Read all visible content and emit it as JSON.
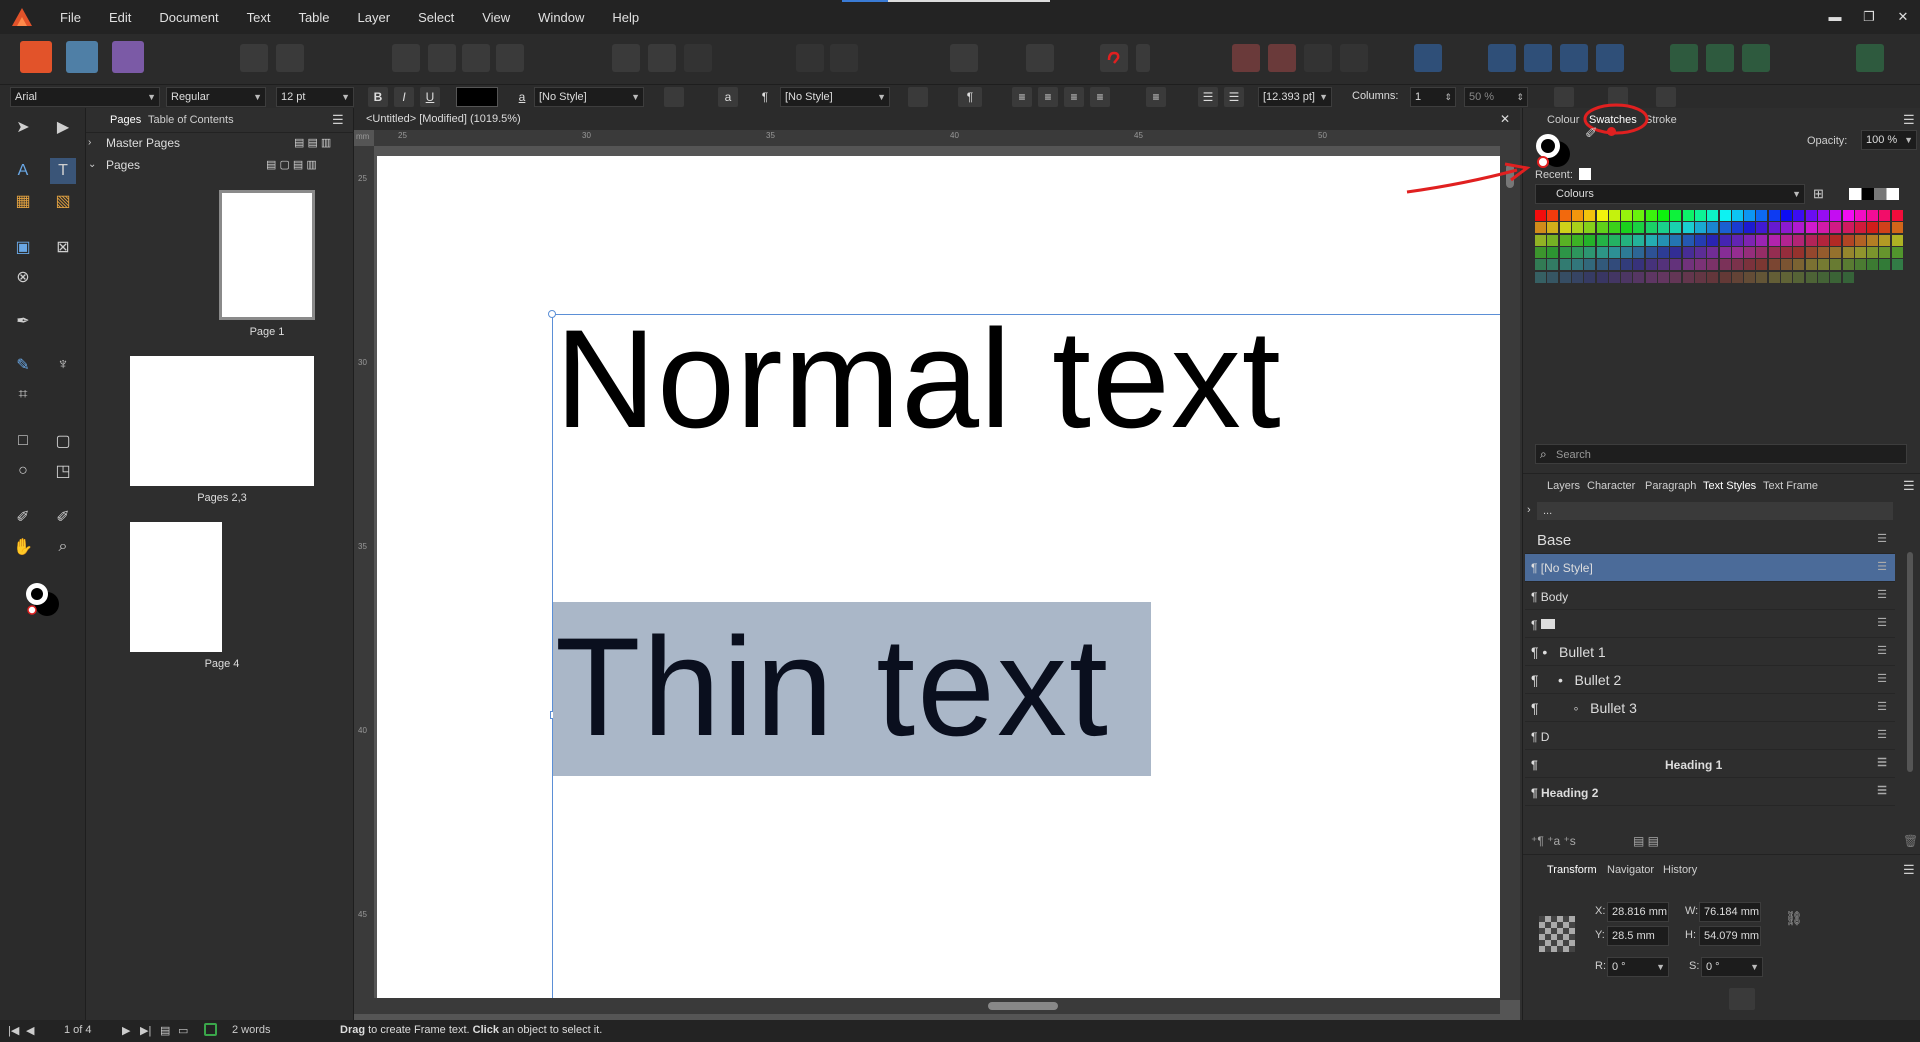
{
  "menu": [
    "File",
    "Edit",
    "Document",
    "Text",
    "Table",
    "Layer",
    "Select",
    "View",
    "Window",
    "Help"
  ],
  "window_controls": {
    "minimize": "▬",
    "maximize": "❐",
    "close": "✕"
  },
  "context": {
    "font_family": "Arial",
    "font_style": "Regular",
    "font_size": "12 pt",
    "bold": "B",
    "italic": "I",
    "underline": "U",
    "char_style_glyph": "a",
    "char_style": "[No Style]",
    "para_glyph": "¶",
    "para_style": "[No Style]",
    "baseline": "[12.393 pt]",
    "columns_label": "Columns:",
    "columns_value": "1",
    "gutter": "50 %",
    "text_color": "#000000"
  },
  "pages_panel": {
    "tabs": [
      "Pages",
      "Table of Contents"
    ],
    "master_pages": "Master Pages",
    "pages_header": "Pages",
    "pages": [
      "Page 1",
      "Pages 2,3",
      "Page 4"
    ]
  },
  "document": {
    "tab_title": "<Untitled> [Modified] (1019.5%)",
    "ruler_unit": "mm",
    "ruler_h": [
      "25",
      "30",
      "35",
      "40",
      "45",
      "50"
    ],
    "ruler_v": [
      "25",
      "30",
      "35",
      "40",
      "45"
    ],
    "text_normal": "Normal text",
    "text_thin": "Thin text"
  },
  "swatches_panel": {
    "tabs": [
      "Colour",
      "Swatches",
      "Stroke"
    ],
    "opacity_label": "Opacity:",
    "opacity_value": "100 %",
    "recent_label": "Recent:",
    "palette": "Colours",
    "search_placeholder": "Search"
  },
  "styles_panel": {
    "tabs": [
      "Layers",
      "Character",
      "Paragraph",
      "Text Styles",
      "Text Frame"
    ],
    "filter": "...",
    "group": "Base",
    "styles": [
      "[No Style]",
      "Body",
      "",
      "Bullet 1",
      "Bullet 2",
      "Bullet 3",
      "D",
      "Heading 1",
      "Heading 2"
    ]
  },
  "transform_panel": {
    "tabs": [
      "Transform",
      "Navigator",
      "History"
    ],
    "x_label": "X:",
    "x": "28.816 mm",
    "w_label": "W:",
    "w": "76.184 mm",
    "y_label": "Y:",
    "y": "28.5 mm",
    "h_label": "H:",
    "h": "54.079 mm",
    "r_label": "R:",
    "r": "0 °",
    "s_label": "S:",
    "s": "0 °"
  },
  "status": {
    "page_of": "1 of 4",
    "word_count": "2 words",
    "hint_bold_1": "Drag",
    "hint_1": " to create Frame text. ",
    "hint_bold_2": "Click",
    "hint_2": " an object to select it."
  },
  "colors": {
    "accent_red": "#e02020",
    "selection": "#aab7c8",
    "active_style": "#4b6b99"
  }
}
